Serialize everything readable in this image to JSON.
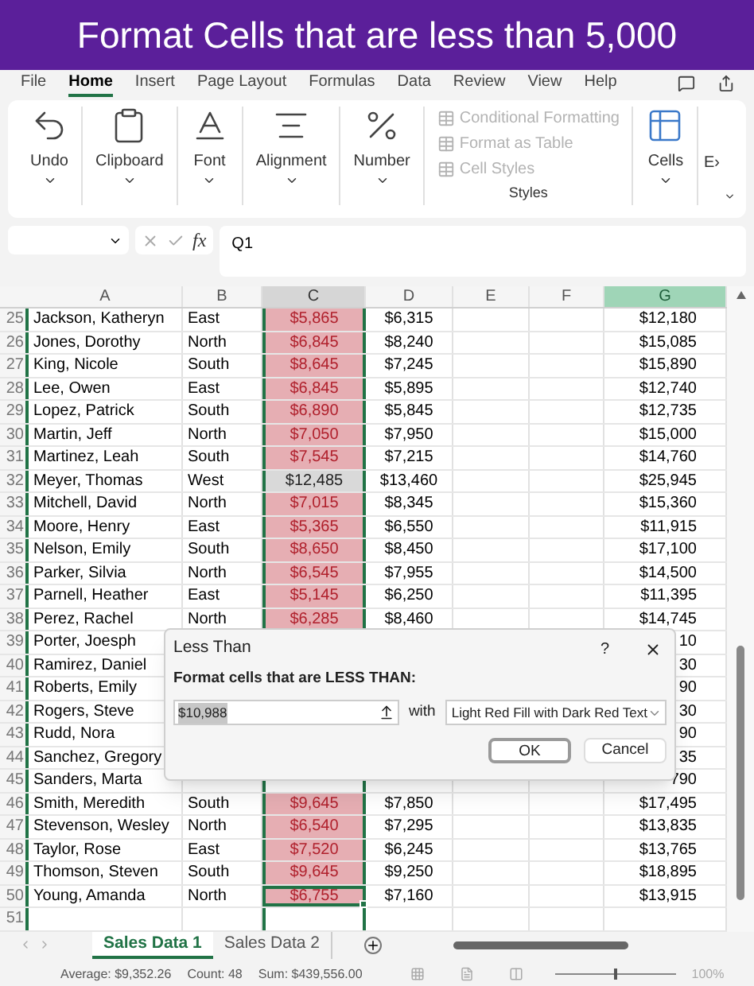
{
  "banner": {
    "title": "Format Cells that are less than 5,000"
  },
  "menu_tabs": [
    {
      "label": "File",
      "selected": false
    },
    {
      "label": "Home",
      "selected": true
    },
    {
      "label": "Insert",
      "selected": false
    },
    {
      "label": "Page Layout",
      "selected": false
    },
    {
      "label": "Formulas",
      "selected": false
    },
    {
      "label": "Data",
      "selected": false
    },
    {
      "label": "Review",
      "selected": false
    },
    {
      "label": "View",
      "selected": false
    },
    {
      "label": "Help",
      "selected": false
    }
  ],
  "ribbon": {
    "groups": [
      {
        "kind": "undo",
        "label": "Undo"
      },
      {
        "kind": "clipboard",
        "label": "Clipboard"
      },
      {
        "kind": "font",
        "label": "Font"
      },
      {
        "kind": "alignment",
        "label": "Alignment"
      },
      {
        "kind": "number",
        "label": "Number"
      }
    ],
    "styles": {
      "label": "Styles",
      "items": [
        {
          "label": "Conditional Formatting",
          "disabled": true
        },
        {
          "label": "Format as Table",
          "disabled": true
        },
        {
          "label": "Cell Styles",
          "disabled": true
        }
      ]
    },
    "cells": {
      "label": "Cells"
    },
    "cut_group": {
      "label": "E›"
    }
  },
  "formula_bar": {
    "fx": "fx",
    "formula": "Q1"
  },
  "columns": [
    {
      "label": "A",
      "selected": false,
      "current": false
    },
    {
      "label": "B",
      "selected": false,
      "current": false
    },
    {
      "label": "C",
      "selected": true,
      "current": false
    },
    {
      "label": "D",
      "selected": false,
      "current": false
    },
    {
      "label": "E",
      "selected": false,
      "current": false
    },
    {
      "label": "F",
      "selected": false,
      "current": false
    },
    {
      "label": "G",
      "selected": false,
      "current": true
    }
  ],
  "rows": [
    {
      "n": "25",
      "a": "Jackson, Katheryn",
      "b": "East",
      "c": "$5,865",
      "highlighted": true,
      "active": false,
      "d": "$6,315",
      "g": "$12,180"
    },
    {
      "n": "26",
      "a": "Jones, Dorothy",
      "b": "North",
      "c": "$6,845",
      "highlighted": true,
      "active": false,
      "d": "$8,240",
      "g": "$15,085"
    },
    {
      "n": "27",
      "a": "King, Nicole",
      "b": "South",
      "c": "$8,645",
      "highlighted": true,
      "active": false,
      "d": "$7,245",
      "g": "$15,890"
    },
    {
      "n": "28",
      "a": "Lee, Owen",
      "b": "East",
      "c": "$6,845",
      "highlighted": true,
      "active": false,
      "d": "$5,895",
      "g": "$12,740"
    },
    {
      "n": "29",
      "a": "Lopez, Patrick",
      "b": "South",
      "c": "$6,890",
      "highlighted": true,
      "active": false,
      "d": "$5,845",
      "g": "$12,735"
    },
    {
      "n": "30",
      "a": "Martin, Jeff",
      "b": "North",
      "c": "$7,050",
      "highlighted": true,
      "active": false,
      "d": "$7,950",
      "g": "$15,000"
    },
    {
      "n": "31",
      "a": "Martinez, Leah",
      "b": "South",
      "c": "$7,545",
      "highlighted": true,
      "active": false,
      "d": "$7,215",
      "g": "$14,760"
    },
    {
      "n": "32",
      "a": "Meyer, Thomas",
      "b": "West",
      "c": "$12,485",
      "highlighted": false,
      "active": false,
      "d": "$13,460",
      "g": "$25,945"
    },
    {
      "n": "33",
      "a": "Mitchell, David",
      "b": "North",
      "c": "$7,015",
      "highlighted": true,
      "active": false,
      "d": "$8,345",
      "g": "$15,360"
    },
    {
      "n": "34",
      "a": "Moore, Henry",
      "b": "East",
      "c": "$5,365",
      "highlighted": true,
      "active": false,
      "d": "$6,550",
      "g": "$11,915"
    },
    {
      "n": "35",
      "a": "Nelson, Emily",
      "b": "South",
      "c": "$8,650",
      "highlighted": true,
      "active": false,
      "d": "$8,450",
      "g": "$17,100"
    },
    {
      "n": "36",
      "a": "Parker, Silvia",
      "b": "North",
      "c": "$6,545",
      "highlighted": true,
      "active": false,
      "d": "$7,955",
      "g": "$14,500"
    },
    {
      "n": "37",
      "a": "Parnell, Heather",
      "b": "East",
      "c": "$5,145",
      "highlighted": true,
      "active": false,
      "d": "$6,250",
      "g": "$11,395"
    },
    {
      "n": "38",
      "a": "Perez, Rachel",
      "b": "North",
      "c": "$6,285",
      "highlighted": true,
      "active": false,
      "d": "$8,460",
      "g": "$14,745"
    },
    {
      "n": "39",
      "a": "Porter, Joesph",
      "g": "10"
    },
    {
      "n": "40",
      "a": "Ramirez, Daniel",
      "g": "30"
    },
    {
      "n": "41",
      "a": "Roberts, Emily",
      "g": "90"
    },
    {
      "n": "42",
      "a": "Rogers, Steve",
      "g": "30"
    },
    {
      "n": "43",
      "a": "Rudd, Nora",
      "g": "90"
    },
    {
      "n": "44",
      "a": "Sanchez, Gregory",
      "g": "35"
    },
    {
      "n": "45",
      "a": "Sanders, Marta",
      "g": "790"
    },
    {
      "n": "46",
      "a": "Smith, Meredith",
      "b": "South",
      "c": "$9,645",
      "highlighted": true,
      "active": false,
      "d": "$7,850",
      "g": "$17,495"
    },
    {
      "n": "47",
      "a": "Stevenson, Wesley",
      "b": "North",
      "c": "$6,540",
      "highlighted": true,
      "active": false,
      "d": "$7,295",
      "g": "$13,835"
    },
    {
      "n": "48",
      "a": "Taylor, Rose",
      "b": "East",
      "c": "$7,520",
      "highlighted": true,
      "active": false,
      "d": "$6,245",
      "g": "$13,765"
    },
    {
      "n": "49",
      "a": "Thomson, Steven",
      "b": "South",
      "c": "$9,645",
      "highlighted": true,
      "active": false,
      "d": "$9,250",
      "g": "$18,895"
    },
    {
      "n": "50",
      "a": "Young, Amanda",
      "b": "North",
      "c": "$6,755",
      "highlighted": true,
      "active": true,
      "d": "$7,160",
      "g": "$13,915"
    },
    {
      "n": "51"
    }
  ],
  "dialog": {
    "title": "Less Than",
    "help": "?",
    "label": "Format cells that are LESS THAN:",
    "field": {
      "value": "$10,988",
      "value_selected": true
    },
    "with": "with",
    "format": "Light Red Fill with Dark Red Text",
    "buttons": [
      {
        "label": "OK",
        "focused": true
      },
      {
        "label": "Cancel",
        "focused": false
      }
    ]
  },
  "sheet_tabs": [
    {
      "label": "Sales Data 1",
      "selected": true
    },
    {
      "label": "Sales Data 2",
      "selected": false
    }
  ],
  "status_bar": {
    "average": "Average: $9,352.26",
    "count": "Count: 48",
    "sum": "Sum: $439,556.00",
    "zoom_slider": {
      "level": 0.5
    },
    "zoom": "100%"
  }
}
